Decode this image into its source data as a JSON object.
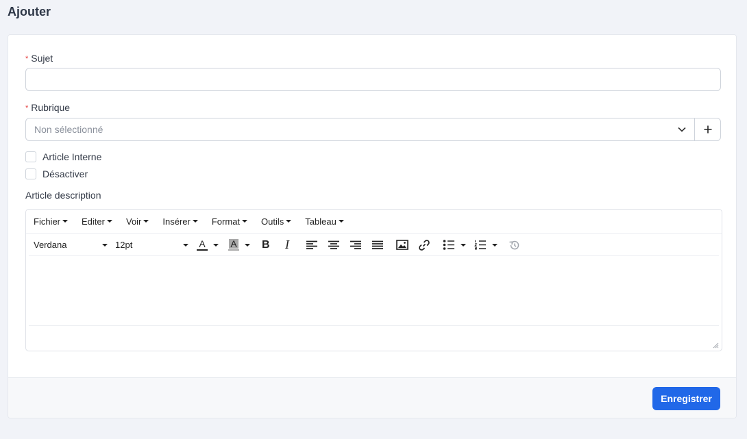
{
  "page": {
    "title": "Ajouter"
  },
  "form": {
    "subject": {
      "label": "Sujet",
      "required_mark": "*",
      "value": ""
    },
    "rubrique": {
      "label": "Rubrique",
      "required_mark": "*",
      "selected": "Non sélectionné",
      "add_symbol": "+"
    },
    "checkboxes": [
      {
        "label": "Article Interne",
        "checked": false
      },
      {
        "label": "Désactiver",
        "checked": false
      }
    ],
    "description_label": "Article description"
  },
  "editor": {
    "menus": [
      "Fichier",
      "Editer",
      "Voir",
      "Insérer",
      "Format",
      "Outils",
      "Tableau"
    ],
    "font_family": "Verdana",
    "font_size": "12pt",
    "text_color_glyph": "A",
    "highlight_glyph": "A",
    "bold_glyph": "B",
    "italic_glyph": "I",
    "icons": [
      "text-color-icon",
      "highlight-color-icon",
      "bold-icon",
      "italic-icon",
      "align-left-icon",
      "align-center-icon",
      "align-right-icon",
      "align-justify-icon",
      "image-icon",
      "link-icon",
      "bullet-list-icon",
      "numbered-list-icon",
      "history-icon",
      "resize-handle-icon"
    ]
  },
  "footer": {
    "save_label": "Enregistrer"
  },
  "colors": {
    "primary": "#2168e8",
    "required": "#e53b3b",
    "background": "#f1f3f8"
  }
}
